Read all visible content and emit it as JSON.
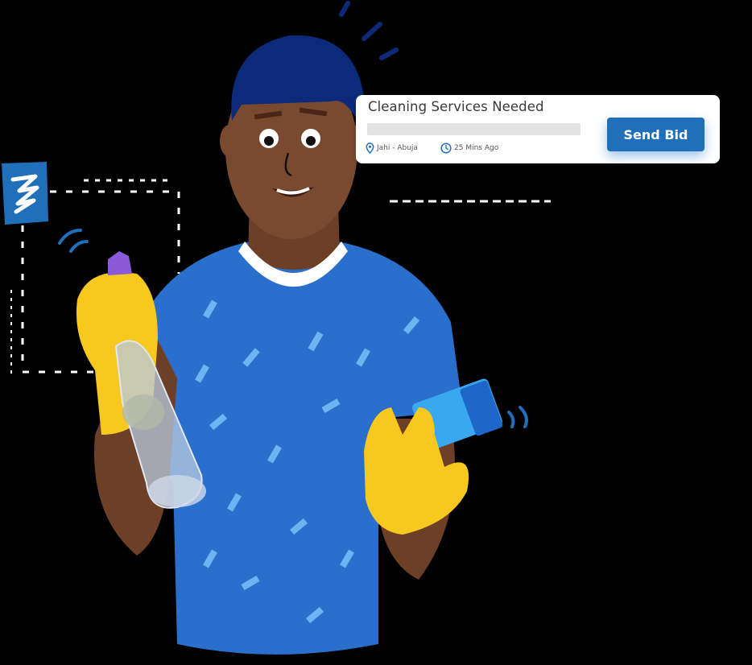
{
  "job_card": {
    "title": "Cleaning Services Needed",
    "location": "Jahi - Abuja",
    "time_posted": "25 Mins Ago",
    "location_icon": "map-pin-icon",
    "time_icon": "clock-icon",
    "bid_button_label": "Send Bid"
  },
  "colors": {
    "background": "#000000",
    "shirt": "#2a6fcb",
    "hair": "#0d2a7a",
    "skin": "#7a4a30",
    "gloves": "#f7c81f",
    "accent_button": "#1f6fba",
    "sponge": "#3aa8f0",
    "spray_nozzle": "#8a5ad8"
  },
  "illustration": {
    "subject": "cleaner-with-spray-bottle-and-sponge",
    "badge_icon": "lightning-logo-icon"
  }
}
